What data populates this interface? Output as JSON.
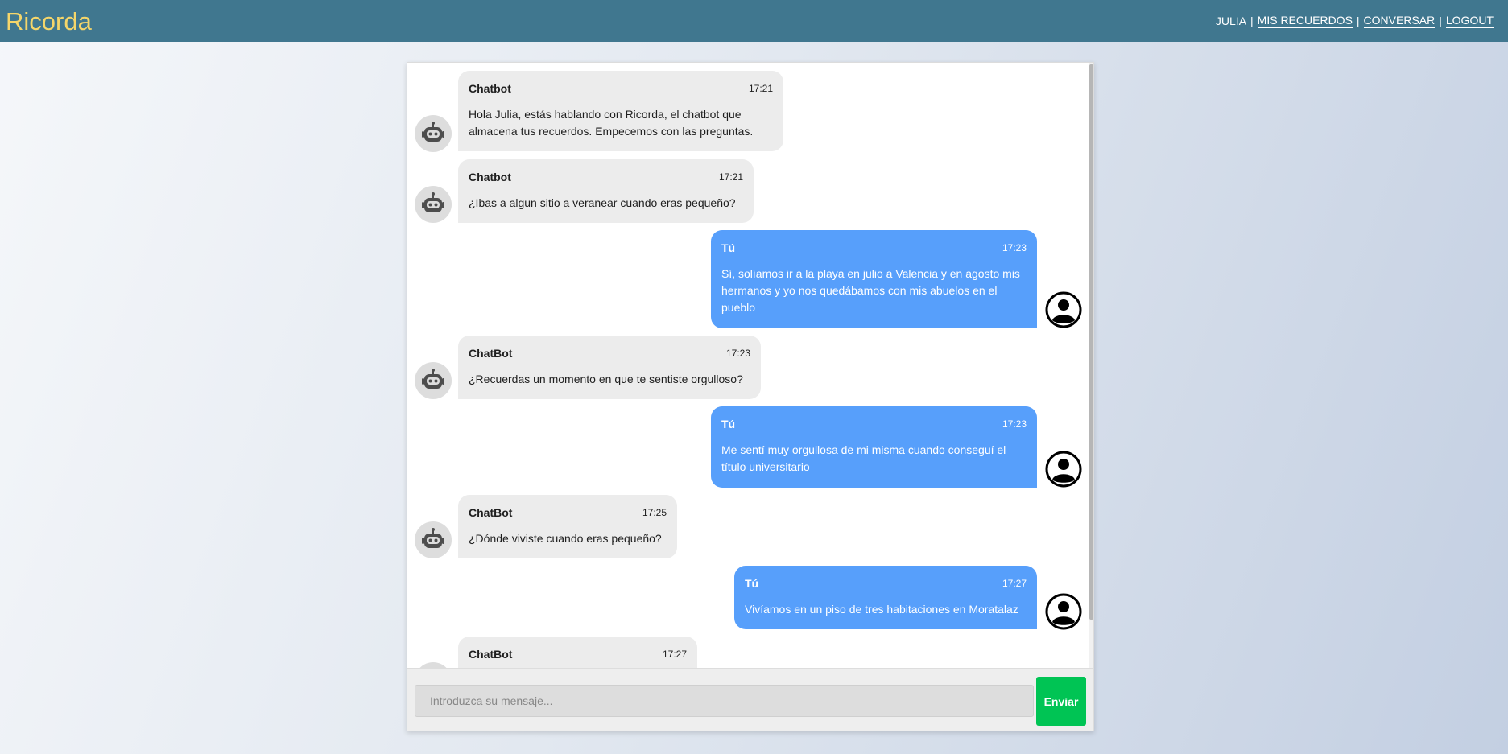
{
  "app": {
    "brand": "Ricorda"
  },
  "nav": {
    "user": "JULIA",
    "items": [
      {
        "label": "MIS RECUERDOS"
      },
      {
        "label": "CONVERSAR"
      },
      {
        "label": "LOGOUT"
      }
    ],
    "separator": "|"
  },
  "chat": {
    "messages": [
      {
        "role": "bot",
        "sender": "Chatbot",
        "time": "17:21",
        "text": "Hola Julia, estás hablando con Ricorda, el chatbot que almacena tus recuerdos. Empecemos con las preguntas."
      },
      {
        "role": "bot",
        "sender": "Chatbot",
        "time": "17:21",
        "text": "¿Ibas a algun sitio a veranear cuando eras pequeño?"
      },
      {
        "role": "user",
        "sender": "Tú",
        "time": "17:23",
        "text": "Sí, solíamos ir a la playa en julio a Valencia y en agosto mis hermanos y yo nos quedábamos con mis abuelos en el pueblo"
      },
      {
        "role": "bot",
        "sender": "ChatBot",
        "time": "17:23",
        "text": "¿Recuerdas un momento en que te sentiste orgulloso?"
      },
      {
        "role": "user",
        "sender": "Tú",
        "time": "17:23",
        "text": "Me sentí muy orgullosa de mi misma cuando conseguí el título universitario"
      },
      {
        "role": "bot",
        "sender": "ChatBot",
        "time": "17:25",
        "text": "¿Dónde viviste cuando eras pequeño?"
      },
      {
        "role": "user",
        "sender": "Tú",
        "time": "17:27",
        "text": "Vivíamos en un piso de tres habitaciones en Moratalaz"
      },
      {
        "role": "bot",
        "sender": "ChatBot",
        "time": "17:27",
        "text": ""
      }
    ]
  },
  "composer": {
    "placeholder": "Introduzca su mensaje...",
    "send_label": "Enviar"
  },
  "colors": {
    "navbar": "#40778f",
    "brand": "#f5d66a",
    "user_bubble": "#579ffb",
    "bot_bubble": "#ececec",
    "send_button": "#00c454"
  },
  "icons": {
    "bot_avatar": "robot-icon",
    "user_avatar": "user-circle-icon"
  }
}
